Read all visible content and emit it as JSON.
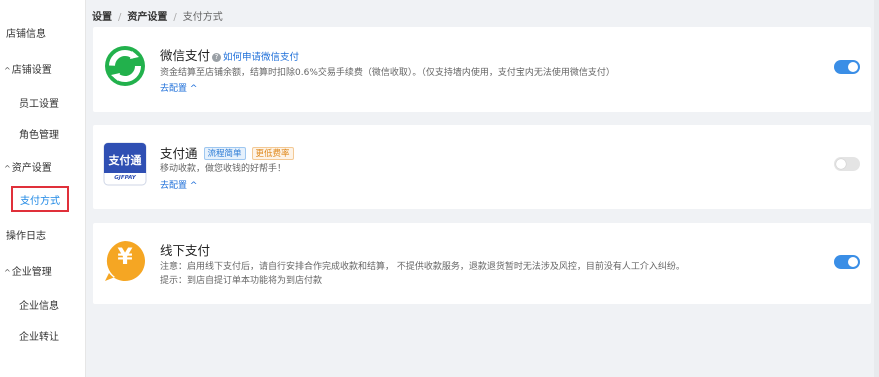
{
  "sidebar": {
    "store_info": "店铺信息",
    "store_settings": "店铺设置",
    "staff_settings": "员工设置",
    "role_management": "角色管理",
    "asset_settings": "资产设置",
    "payment_methods": "支付方式",
    "operation_log": "操作日志",
    "enterprise_management": "企业管理",
    "enterprise_info": "企业信息",
    "enterprise_transfer": "企业转让",
    "chevron": "^"
  },
  "breadcrumb": {
    "level1": "设置",
    "level2": "资产设置",
    "current": "支付方式",
    "separator": "/"
  },
  "wechat": {
    "title": "微信支付",
    "info_icon": "?",
    "help_link": "如何申请微信支付",
    "description": "资金结算至店铺余额，结算时扣除0.6%交易手续费（微信收取）。（仅支持墙内使用，支付宝内无法使用微信支付）",
    "config_link": "去配置 ^",
    "enabled": true,
    "brand_color": "#1db954"
  },
  "fuiou": {
    "title": "支付通",
    "tag1": "流程简单",
    "tag2": "更低费率",
    "logo_text": "支付通",
    "logo_subtext": "GJFPAY",
    "description": "移动收款，做您收钱的好帮手！",
    "config_link": "去配置 ^",
    "enabled": false,
    "brand_color": "#2f4fb3"
  },
  "offline": {
    "title": "线下支付",
    "logo_symbol": "¥",
    "notice": "注意：启用线下支付后，请自行安排合作完成收款和结算，       不提供收款服务，退款退货暂时无法涉及风控，目前没有人工介入纠纷。",
    "hint": "提示：到店自提订单本功能将为到店付款",
    "enabled": true,
    "brand_color": "#f5a623"
  },
  "colors": {
    "accent": "#3a8ee6",
    "link": "#1e6fd9",
    "highlight_border": "#e0303a",
    "page_bg": "#f0f2f5"
  }
}
